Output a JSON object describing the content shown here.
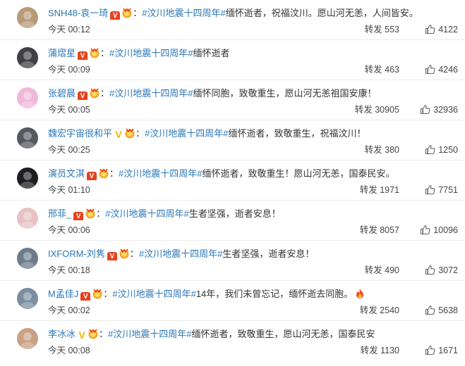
{
  "comments": [
    {
      "user": "SNH48-袁一琦",
      "badge": "V",
      "badge_color": "red",
      "topic": "#汶川地震十四周年#",
      "text": "缅怀逝者，祝福汶川。愿山河无恙，人间皆安。",
      "time": "今天 00:12",
      "repost_label": "转发",
      "reposts": "553",
      "likes": "4122",
      "avatar": "#b89a78",
      "fire": false
    },
    {
      "user": "蒲熠星",
      "badge": "V",
      "badge_color": "red",
      "topic": "#汶川地震十四周年#",
      "text": "缅怀逝者",
      "time": "今天 00:09",
      "repost_label": "转发",
      "reposts": "463",
      "likes": "4246",
      "avatar": "#3f3f46",
      "fire": false
    },
    {
      "user": "张碧晨",
      "badge": "V",
      "badge_color": "red",
      "topic": "#汶川地震十四周年#",
      "text": "缅怀同胞，致敬重生，愿山河无恙祖国安康！",
      "time": "今天 00:05",
      "repost_label": "转发",
      "reposts": "30905",
      "likes": "32936",
      "avatar": "#f0b8d8",
      "fire": false
    },
    {
      "user": "魏宏宇宙很和平",
      "badge": "V",
      "badge_color": "gold",
      "topic": "#汶川地震十四周年#",
      "text": "缅怀逝者，致敬重生，祝福汶川！",
      "time": "今天 00:25",
      "repost_label": "转发",
      "reposts": "380",
      "likes": "1250",
      "avatar": "#55585e",
      "fire": false
    },
    {
      "user": "演员文淇",
      "badge": "V",
      "badge_color": "red",
      "topic": "#汶川地震十四周年#",
      "text": "缅怀逝者，致敬重生！愿山河无恙，国泰民安。",
      "time": "今天 01:10",
      "repost_label": "转发",
      "reposts": "1971",
      "likes": "7751",
      "avatar": "#1e1e22",
      "fire": false
    },
    {
      "user": "邢菲_",
      "badge": "V",
      "badge_color": "red",
      "topic": "#汶川地震十四周年#",
      "text": "生者坚强，逝者安息！",
      "time": "今天 00:06",
      "repost_label": "转发",
      "reposts": "8057",
      "likes": "10096",
      "avatar": "#e7c2c4",
      "fire": false
    },
    {
      "user": "IXFORM-刘隽",
      "badge": "V",
      "badge_color": "red",
      "topic": "#汶川地震十四周年#",
      "text": "生者坚强，逝者安息！",
      "time": "今天 00:18",
      "repost_label": "转发",
      "reposts": "490",
      "likes": "3072",
      "avatar": "#6b7d8c",
      "fire": false
    },
    {
      "user": "M孟佳J",
      "badge": "V",
      "badge_color": "red",
      "topic": "#汶川地震十四周年#",
      "text": "14年，我们未曾忘记，缅怀逝去同胞。",
      "time": "今天 00:02",
      "repost_label": "转发",
      "reposts": "2540",
      "likes": "5638",
      "avatar": "#7a8ea0",
      "fire": true
    },
    {
      "user": "李冰冰",
      "badge": "V",
      "badge_color": "gold",
      "topic": "#汶川地震十四周年#",
      "text": "缅怀逝者，致敬重生，愿山河无恙，国泰民安",
      "time": "今天 00:08",
      "repost_label": "转发",
      "reposts": "1130",
      "likes": "1671",
      "avatar": "#c9a184",
      "fire": false
    }
  ],
  "colon": "："
}
